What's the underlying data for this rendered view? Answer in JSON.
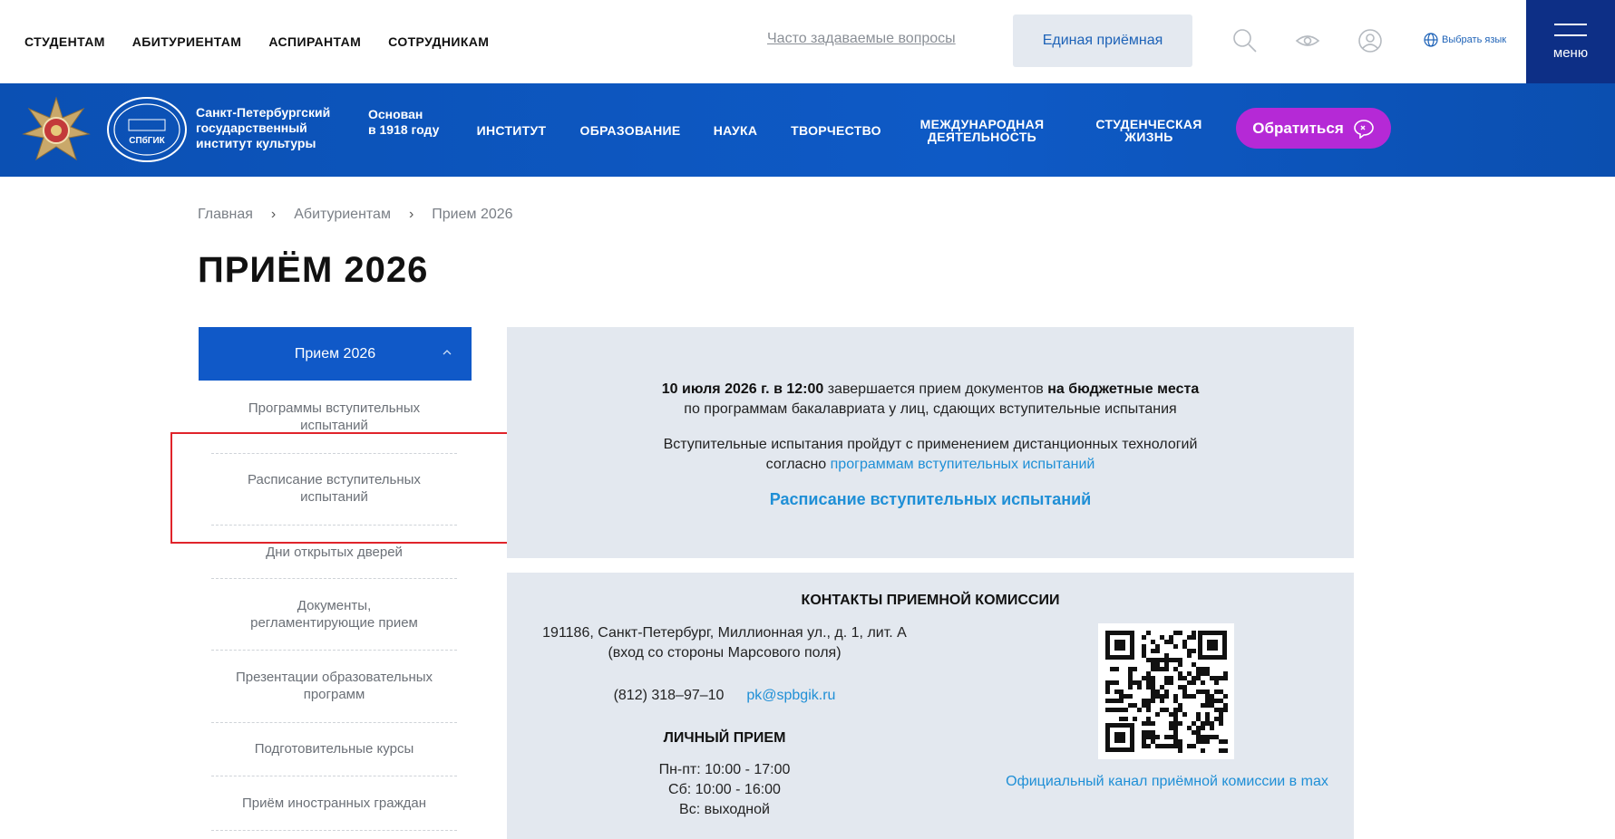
{
  "topbar": {
    "nav": [
      "СТУДЕНТАМ",
      "АБИТУРИЕНТАМ",
      "АСПИРАНТАМ",
      "СОТРУДНИКАМ"
    ],
    "faq_link": "Часто задаваемые вопросы",
    "unified_button": "Единая приёмная",
    "icons": [
      "search-icon",
      "eye-icon",
      "user-icon",
      "globe-icon"
    ],
    "language": "Выбрать язык",
    "menu_label": "меню"
  },
  "header": {
    "emblem_text": "СПбГИК",
    "institute_name": [
      "Санкт-Петербургский",
      "государственный",
      "институт культуры"
    ],
    "founded": [
      "Основан",
      "в 1918 году"
    ],
    "nav": [
      {
        "label": [
          "ИНСТИТУТ"
        ]
      },
      {
        "label": [
          "ОБРАЗОВАНИЕ"
        ]
      },
      {
        "label": [
          "НАУКА"
        ]
      },
      {
        "label": [
          "ТВОРЧЕСТВО"
        ]
      },
      {
        "label": [
          "МЕЖДУНАРОДНАЯ",
          "ДЕЯТЕЛЬНОСТЬ"
        ]
      },
      {
        "label": [
          "СТУДЕНЧЕСКАЯ",
          "ЖИЗНЬ"
        ]
      }
    ],
    "contact_button": "Обратиться"
  },
  "breadcrumb": [
    "Главная",
    "Абитуриентам",
    "Прием 2026"
  ],
  "page_title": "ПРИЁМ 2026",
  "sidebar": {
    "active": "Прием 2026",
    "items": [
      [
        "Программы вступительных",
        "испытаний"
      ],
      [
        "Расписание вступительных",
        "испытаний"
      ],
      [
        "Дни открытых дверей"
      ],
      [
        "Документы,",
        "регламентирующие прием"
      ],
      [
        "Презентации образовательных",
        "программ"
      ],
      [
        "Подготовительные курсы"
      ],
      [
        "Приём иностранных граждан"
      ]
    ]
  },
  "notice": {
    "date_bold": "10 июля 2026 г. в 12:00",
    "text1": " завершается прием документов ",
    "bold2": "на бюджетные места",
    "line2": "по программам бакалавриата у лиц, сдающих вступительные испытания",
    "line3": "Вступительные испытания пройдут с применением дистанционных технологий",
    "line4_prefix": "согласно ",
    "line4_link": "программам вступительных испытаний",
    "schedule_link": "Расписание вступительных испытаний"
  },
  "contacts": {
    "title": "КОНТАКТЫ ПРИЕМНОЙ КОМИССИИ",
    "address": [
      "191186, Санкт-Петербург, Миллионная ул., д. 1, лит. А",
      "(вход со стороны Марсового поля)"
    ],
    "phone": "(812) 318–97–10",
    "email": "pk@spbgik.ru",
    "personal_title": "ЛИЧНЫЙ ПРИЕМ",
    "hours": [
      "Пн-пт: 10:00 - 17:00",
      "Сб: 10:00 - 16:00",
      "Вс: выходной"
    ],
    "channel_link": "Официальный канал приёмной комиссии в max"
  }
}
